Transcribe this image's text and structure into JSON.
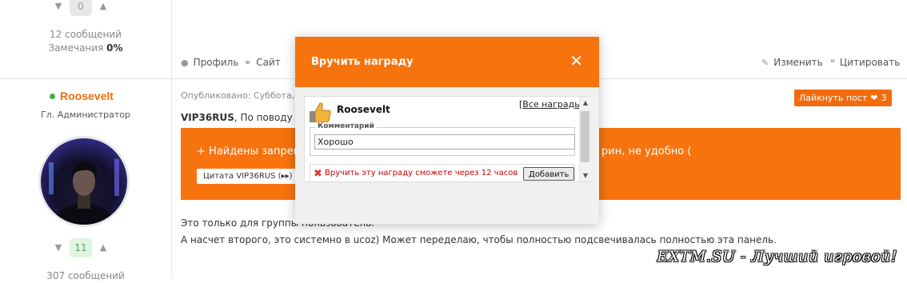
{
  "prev_post": {
    "vote_count": "0",
    "messages": "12 сообщений",
    "warnings_label": "Замечания",
    "warnings_value": "0%"
  },
  "actions": {
    "profile": "Профиль",
    "site": "Сайт",
    "edit": "Изменить",
    "quote": "Цитировать"
  },
  "post": {
    "username": "Roosevelt",
    "rank": "Гл. Администратор",
    "vote_count": "11",
    "messages_partial": "307 сообщений",
    "published": "Опубликовано: Суббота, Се",
    "like_label": "Лайкнуть пост",
    "like_count": "3",
    "quote_author": "VIP36RUS",
    "quote_intro": ", По поводу п",
    "quote_text_left": "+ Найдены запреще",
    "quote_text_right": "рин, не удобно (",
    "quote_button": "Цитата VIP36RUS (▸▸)",
    "body_line1": "Это только для группы пользователь.",
    "body_line2": "А насчет второго, это системно в ucoz) Может переделаю, чтобы полностью подсвечивалась полностью эта панель."
  },
  "modal": {
    "title": "Вручить награду",
    "close": "✕",
    "user": "Roosevelt",
    "all_awards": "Все награды",
    "comment_label": "Комментарий",
    "comment_value": "Хорошо",
    "error_text": "Вручить эту награду сможете через 12 часов",
    "add_button": "Добавить"
  },
  "watermark": "EXTM.SU - Лучший игровой!",
  "colors": {
    "accent": "#f7730e",
    "online": "#3cb043",
    "error": "#c00000"
  }
}
